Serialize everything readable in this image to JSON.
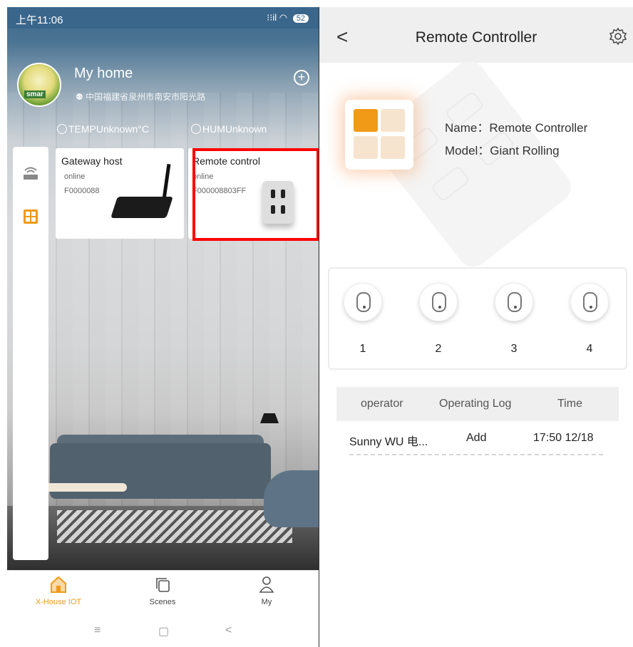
{
  "left": {
    "status_bar": {
      "time": "上午11:06",
      "signal": "⁝⁝il",
      "battery": "52"
    },
    "home": {
      "title": "My home",
      "address": "中国福建省泉州市南安市阳光路",
      "avatar_label": "smar"
    },
    "sensors": {
      "temp": "TEMPUnknown°C",
      "hum": "HUMUnknown"
    },
    "devices": [
      {
        "name": "Gateway host",
        "status": "online",
        "sn": "F0000088"
      },
      {
        "name": "Remote control",
        "status": "online",
        "sn": "F000008803FF"
      }
    ],
    "nav": [
      {
        "label": "X-House IOT",
        "active": true
      },
      {
        "label": "Scenes",
        "active": false
      },
      {
        "label": "My",
        "active": false
      }
    ],
    "sys_nav": {
      "menu": "≡",
      "home": "▢",
      "back": "<"
    },
    "colors": {
      "accent": "#f09a18",
      "status_bar": "#3b668b",
      "highlight": "#ff0000"
    }
  },
  "right": {
    "header": {
      "title": "Remote Controller",
      "back": "<"
    },
    "device": {
      "name": "Name：Remote Controller",
      "model": "Model：Giant Rolling"
    },
    "keys": [
      "1",
      "2",
      "3",
      "4"
    ],
    "log": {
      "headers": [
        "operator",
        "Operating Log",
        "Time"
      ],
      "rows": [
        {
          "operator": "Sunny WU 电...",
          "action": "Add",
          "time": "17:50 12/18"
        }
      ]
    }
  }
}
